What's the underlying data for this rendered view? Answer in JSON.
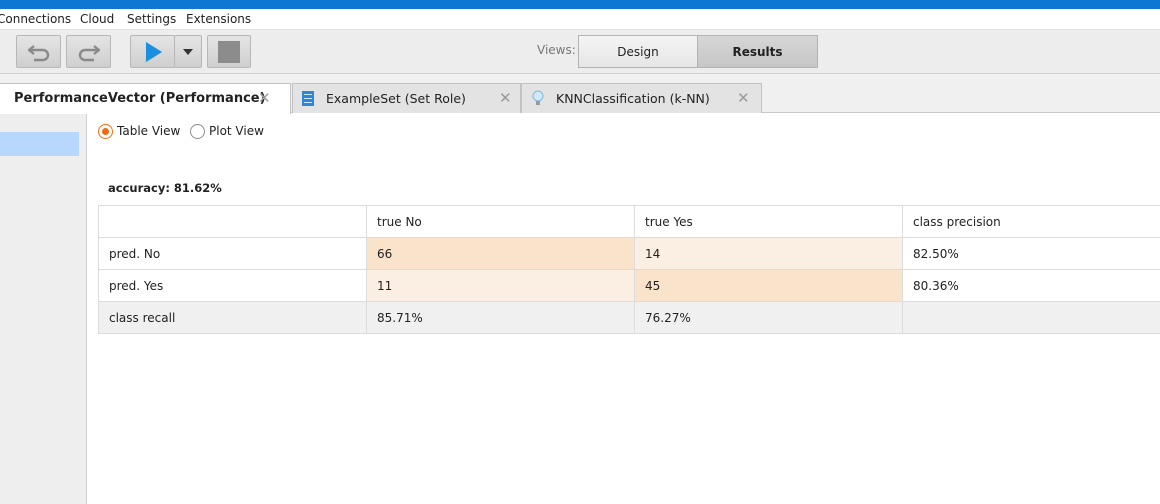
{
  "menu": {
    "items": [
      {
        "label": "Connections"
      },
      {
        "label": "Cloud"
      },
      {
        "label": "Settings"
      },
      {
        "label": "Extensions"
      }
    ]
  },
  "toolbar": {
    "undo_icon": "undo-icon",
    "redo_icon": "redo-icon",
    "run_icon": "play-icon",
    "run_menu_icon": "dropdown-arrow-icon",
    "stop_icon": "stop-icon",
    "views_label": "Views:",
    "design_label": "Design",
    "results_label": "Results"
  },
  "tabs": [
    {
      "label": "PerformanceVector (Performance)",
      "active": true
    },
    {
      "label": "ExampleSet (Set Role)",
      "icon": "table-icon"
    },
    {
      "label": "KNNClassification (k-NN)",
      "icon": "lightbulb-icon"
    }
  ],
  "view_options": {
    "table_view": "Table View",
    "plot_view": "Plot View",
    "selected": "Table View"
  },
  "performance": {
    "accuracy": "accuracy: 81.62%",
    "headers": [
      "",
      "true No",
      "true Yes",
      "class precision"
    ],
    "rows": [
      [
        "pred. No",
        "66",
        "14",
        "82.50%"
      ],
      [
        "pred. Yes",
        "11",
        "45",
        "80.36%"
      ],
      [
        "class recall",
        "85.71%",
        "76.27%",
        ""
      ]
    ]
  },
  "colors": {
    "accent": "#1076d4",
    "radio_selected": "#f06c11",
    "cell_high": "#f9e4cb",
    "cell_low": "#faefe2",
    "selection": "#b7d8fb"
  }
}
